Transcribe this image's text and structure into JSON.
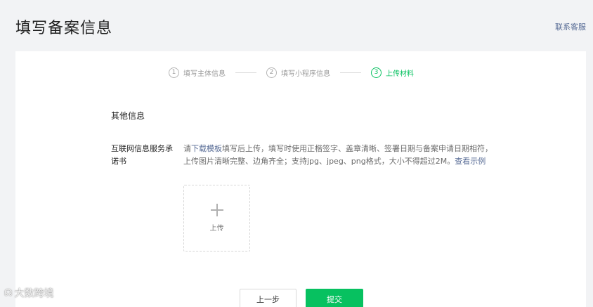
{
  "header": {
    "title": "填写备案信息",
    "contact_label": "联系客服"
  },
  "stepper": {
    "steps": [
      {
        "num": "1",
        "label": "填写主体信息",
        "active": false
      },
      {
        "num": "2",
        "label": "填写小程序信息",
        "active": false
      },
      {
        "num": "3",
        "label": "上传材料",
        "active": true
      }
    ]
  },
  "section": {
    "title": "其他信息"
  },
  "field": {
    "label": "互联网信息服务承诺书",
    "desc_prefix": "请",
    "download_link": "下载模板",
    "desc_body": "填写后上传，填写时使用正楷签字、盖章清晰、签署日期与备案申请日期相符，上传图片清晰完整、边角齐全；支持jpg、jpeg、png格式，大小不得超过2M。",
    "example_link": "查看示例"
  },
  "upload": {
    "label": "上传",
    "icon": "plus-icon"
  },
  "actions": {
    "prev_label": "上一步",
    "submit_label": "提交"
  },
  "watermark": {
    "text": "大数跨境"
  },
  "colors": {
    "accent": "#07c160",
    "link": "#576b95"
  }
}
